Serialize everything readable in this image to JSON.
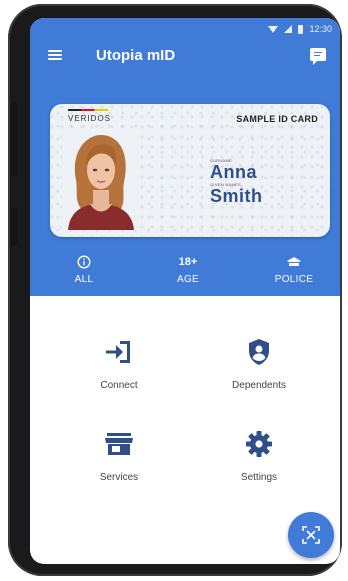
{
  "status_bar": {
    "time": "12:30"
  },
  "app_bar": {
    "title": "Utopia mID"
  },
  "id_card": {
    "brand": "VERIDOS",
    "card_type": "SAMPLE ID CARD",
    "surname_label": "SURNAME",
    "surname": "Anna",
    "given_names_label": "GIVEN NAMES",
    "given_names": "Smith"
  },
  "age_info": [
    {
      "top": "",
      "icon": "info-icon",
      "label": "ALL"
    },
    {
      "top": "18+",
      "icon": "",
      "label": "AGE"
    },
    {
      "top": "",
      "icon": "police-cap-icon",
      "label": "POLICE"
    }
  ],
  "tiles": [
    {
      "label": "Connect",
      "icon": "login-icon"
    },
    {
      "label": "Dependents",
      "icon": "shield-user-icon"
    },
    {
      "label": "Services",
      "icon": "storefront-icon"
    },
    {
      "label": "Settings",
      "icon": "gear-icon"
    }
  ],
  "fab": {
    "icon": "scan-icon"
  },
  "colors": {
    "primary": "#3f7bd7",
    "card_text": "#2e4f8a",
    "icon_dark": "#2f4f88"
  }
}
